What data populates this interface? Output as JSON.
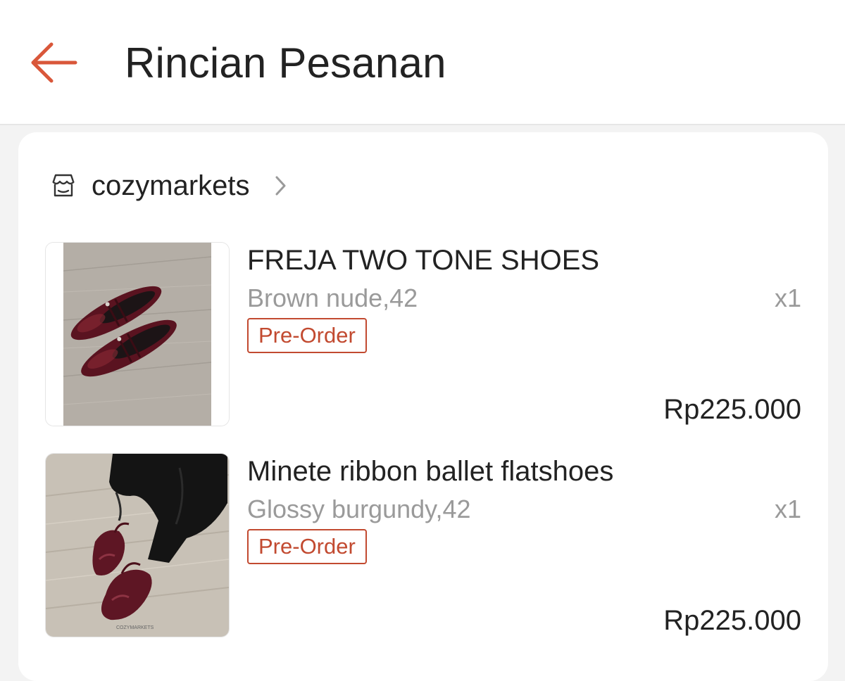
{
  "header": {
    "title": "Rincian Pesanan",
    "back_icon": "arrow-left-icon",
    "accent_color": "#d9573a"
  },
  "shop": {
    "name": "cozymarkets",
    "icon": "store-icon",
    "chevron_icon": "chevron-right-icon"
  },
  "products": [
    {
      "name": "FREJA TWO TONE SHOES",
      "variant": "Brown nude,42",
      "quantity": "x1",
      "badge": "Pre-Order",
      "price": "Rp225.000",
      "image": "burgundy-shoes-photo"
    },
    {
      "name": "Minete ribbon ballet flatshoes",
      "variant": "Glossy burgundy,42",
      "quantity": "x1",
      "badge": "Pre-Order",
      "price": "Rp225.000",
      "image": "worn-ballet-flats-photo",
      "image_watermark": "COZYMARKETS"
    }
  ]
}
